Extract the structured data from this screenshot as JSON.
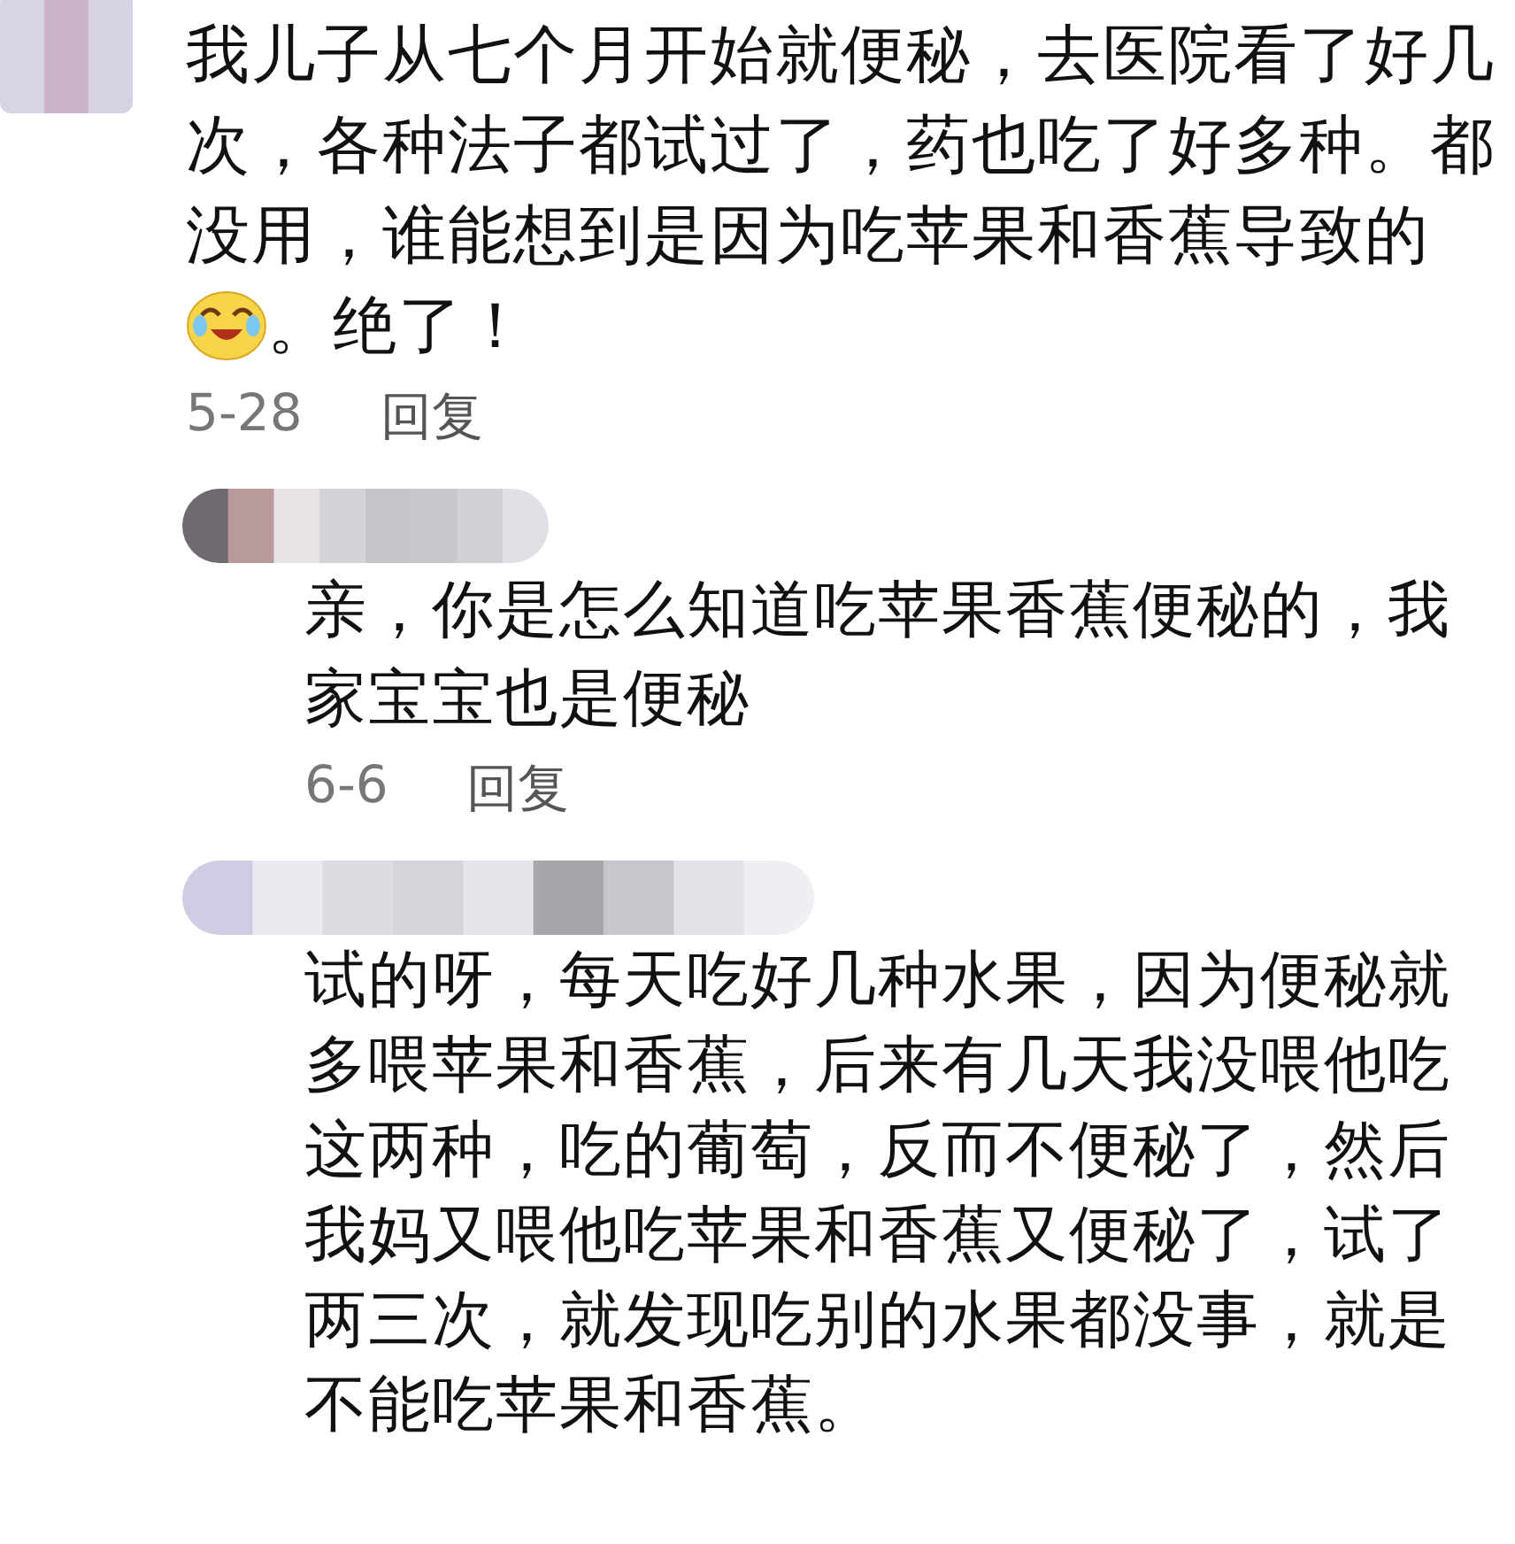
{
  "comment": {
    "text": "我儿子从七个月开始就便秘，去医院看了好几次，各种法子都试过了，药也吃了好多种。都没用，谁能想到是因为吃苹果和香蕉导致的",
    "text_after_emoji": "。绝了！",
    "date": "5-28",
    "reply_label": "回复"
  },
  "replies": [
    {
      "text": "亲，你是怎么知道吃苹果香蕉便秘的，我家宝宝也是便秘",
      "date": "6-6",
      "reply_label": "回复"
    },
    {
      "text": "试的呀，每天吃好几种水果，因为便秘就多喂苹果和香蕉，后来有几天我没喂他吃这两种，吃的葡萄，反而不便秘了，然后我妈又喂他吃苹果和香蕉又便秘了，试了两三次，就发现吃别的水果都没事，就是不能吃苹果和香蕉。"
    }
  ]
}
